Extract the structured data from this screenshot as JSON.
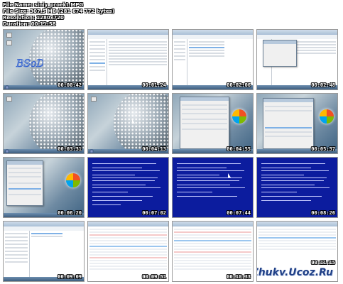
{
  "header": {
    "file_name": "File Name: siniy_proekt.MPG",
    "file_size": "File Size: 307,5 MB (281 674 772 bytes)",
    "resolution": "Resolution: 1280x720",
    "duration": "Duration: 00:11:58"
  },
  "thumbnails": [
    {
      "time": "00:00:42",
      "kind": "desktop",
      "label": "BSoD"
    },
    {
      "time": "00:01:24",
      "kind": "explorer"
    },
    {
      "time": "00:02:06",
      "kind": "explorer-list"
    },
    {
      "time": "00:02:48",
      "kind": "explorer-dialog"
    },
    {
      "time": "00:03:31",
      "kind": "desktop"
    },
    {
      "time": "00:04:13",
      "kind": "desktop-cursor"
    },
    {
      "time": "00:04:55",
      "kind": "sysprops"
    },
    {
      "time": "00:05:37",
      "kind": "sysprops"
    },
    {
      "time": "00:06:20",
      "kind": "sysprops-small"
    },
    {
      "time": "00:07:02",
      "kind": "bsod"
    },
    {
      "time": "00:07:44",
      "kind": "bsod"
    },
    {
      "time": "00:08:26",
      "kind": "bsod"
    },
    {
      "time": "00:09:09",
      "kind": "explorer"
    },
    {
      "time": "00:09:51",
      "kind": "regedit"
    },
    {
      "time": "00:10:33",
      "kind": "regedit"
    },
    {
      "time": "00:11:15",
      "kind": "regedit"
    }
  ],
  "watermark": "Zhukv.Ucoz.Ru",
  "colors": {
    "bsod": "#0c1c9e",
    "watermark": "#1f3f86"
  }
}
